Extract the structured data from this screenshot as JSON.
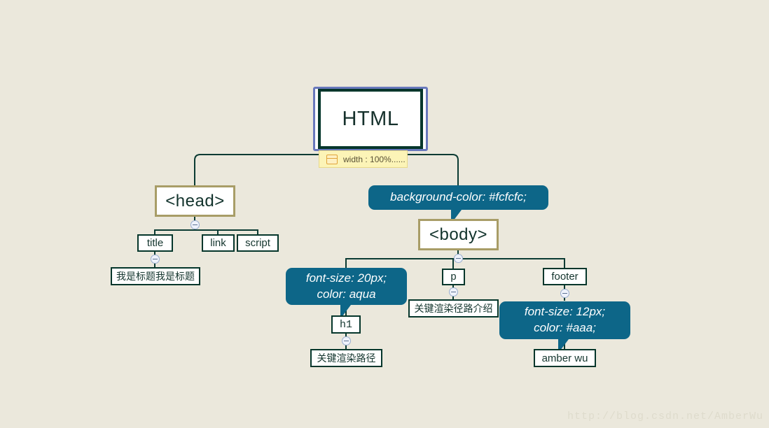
{
  "diagram": {
    "background_color": "#ebe8dc",
    "edge_color": "#0b3b33",
    "callout_color": "#0d6688",
    "tan_border_color": "#a89d67",
    "root_ring_color": "#6878bc"
  },
  "nodes": {
    "root": {
      "label": "HTML"
    },
    "head": {
      "label": "<head>"
    },
    "title": {
      "label": "title"
    },
    "link": {
      "label": "link"
    },
    "script": {
      "label": "script"
    },
    "title_text": {
      "label": "我是标题我是标题"
    },
    "body": {
      "label": "<body>"
    },
    "h1": {
      "label": "h1"
    },
    "h1_text": {
      "label": "关键渲染路径"
    },
    "p": {
      "label": "p"
    },
    "p_text": {
      "label": "关键渲染径路介绍"
    },
    "footer": {
      "label": "footer"
    },
    "footer_text": {
      "label": "amber wu"
    }
  },
  "callouts": {
    "body_style": {
      "line1": "background-color: #fcfcfc;"
    },
    "h1_style": {
      "line1": "font-size: 20px;",
      "line2": "color: aqua"
    },
    "footer_style": {
      "line1": "font-size: 12px;",
      "line2": "color: #aaa;"
    }
  },
  "note": {
    "root_note": "width : 100%......",
    "icon": "note-lines-icon"
  },
  "watermark": {
    "text": "http://blog.csdn.net/AmberWu"
  }
}
